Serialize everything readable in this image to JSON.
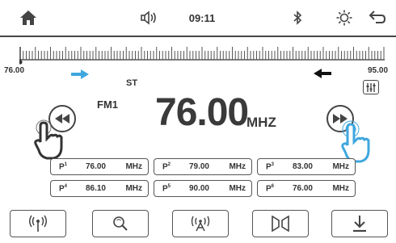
{
  "status_bar": {
    "home_icon": "home-icon",
    "screen_mode_icon": "speaker-mode-icon",
    "time": "09:11",
    "bluetooth_icon": "bluetooth-icon",
    "brightness_icon": "sun-icon",
    "back_icon": "back-arrow-icon"
  },
  "tuner": {
    "min_freq": "76.00",
    "max_freq": "95.00",
    "stereo": "ST",
    "band": "FM1",
    "frequency": "76.00",
    "unit": "MHZ",
    "marker_position_fraction": 0.0,
    "accent_color": "#3fa7de"
  },
  "presets": [
    {
      "label": "P",
      "num": "1",
      "freq": "76.00",
      "unit": "MHz"
    },
    {
      "label": "P",
      "num": "2",
      "freq": "79.00",
      "unit": "MHz"
    },
    {
      "label": "P",
      "num": "3",
      "freq": "83.00",
      "unit": "MHz"
    },
    {
      "label": "P",
      "num": "4",
      "freq": "86.10",
      "unit": "MHz"
    },
    {
      "label": "P",
      "num": "5",
      "freq": "90.00",
      "unit": "MHz"
    },
    {
      "label": "P",
      "num": "6",
      "freq": "76.00",
      "unit": "MHz"
    }
  ],
  "bottom_bar": [
    {
      "icon": "antenna-icon"
    },
    {
      "icon": "search-icon"
    },
    {
      "icon": "scan-icon"
    },
    {
      "icon": "stereo-mono-icon"
    },
    {
      "icon": "save-download-icon"
    }
  ]
}
